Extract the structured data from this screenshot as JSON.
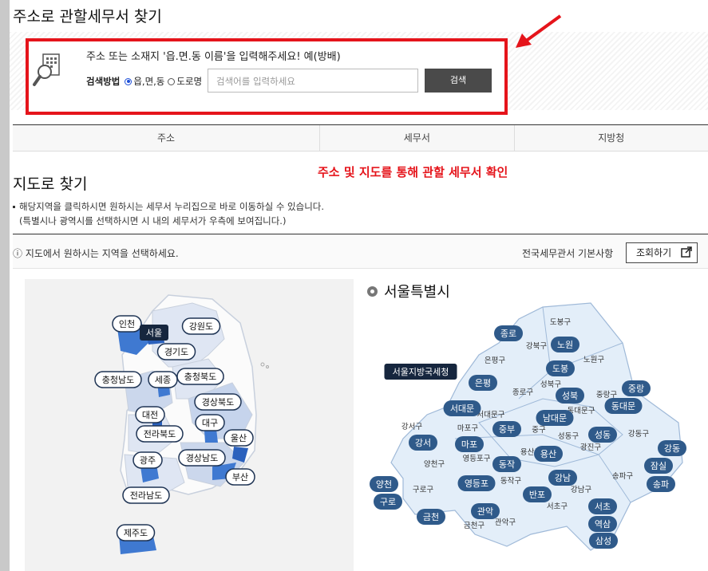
{
  "page": {
    "title": "주소로 관할세무서 찾기"
  },
  "search": {
    "instruction": "주소 또는 소재지 '읍.면.동 이름'을 입력해주세요! 예(방배)",
    "method_label": "검색방법",
    "option_dong": "읍,면,동",
    "option_road": "도로명",
    "placeholder": "검색어를 입력하세요",
    "button": "검색"
  },
  "table_headers": [
    "주소",
    "세무서",
    "지방청"
  ],
  "map_section": {
    "title": "지도로 찾기",
    "annotation": "주소 및 지도를 통해 관할 세무서 확인",
    "note1": "해당지역을 클릭하시면 원하시는 세무서 누리집으로 바로 이동하실 수 있습니다.",
    "note2": "(특별시나 광역시를 선택하시면 시 내의 세무서가 우측에 보여집니다.)",
    "info": "ⓘ 지도에서 원하시는 지역을 선택하세요.",
    "link": "전국세무관서 기본사항",
    "button": "조회하기"
  },
  "korea_regions": [
    "인천",
    "서울",
    "강원도",
    "경기도",
    "충청남도",
    "세종",
    "충청북도",
    "경상북도",
    "대전",
    "대구",
    "전라북도",
    "울산",
    "광주",
    "경상남도",
    "부산",
    "전라남도",
    "제주도"
  ],
  "seoul": {
    "title": "서울특별시",
    "offices": [
      "종로",
      "노원",
      "도봉",
      "은평",
      "성북",
      "중랑",
      "서대문",
      "남대문",
      "동대문",
      "중부",
      "성동",
      "강동",
      "서초",
      "강서",
      "마포",
      "용산",
      "잠실",
      "송파",
      "동작",
      "강남",
      "양천",
      "영등포",
      "반포",
      "구로",
      "관악",
      "금천",
      "역삼",
      "삼성",
      "서울지방국세청"
    ],
    "districts": [
      "도봉구",
      "강북구",
      "노원구",
      "은평구",
      "성북구",
      "중랑구",
      "종로구",
      "동대문구",
      "서대문구",
      "중구",
      "광진구",
      "성동구",
      "강동구",
      "강서구",
      "마포구",
      "용산구",
      "양천구",
      "영등포구",
      "동작구",
      "송파구",
      "강남구",
      "구로구",
      "서초구",
      "관악구",
      "금천구"
    ]
  },
  "colors": {
    "accent_red": "#e5141b",
    "office_blue": "#2f5a8a",
    "dark_navy": "#1f3454"
  }
}
